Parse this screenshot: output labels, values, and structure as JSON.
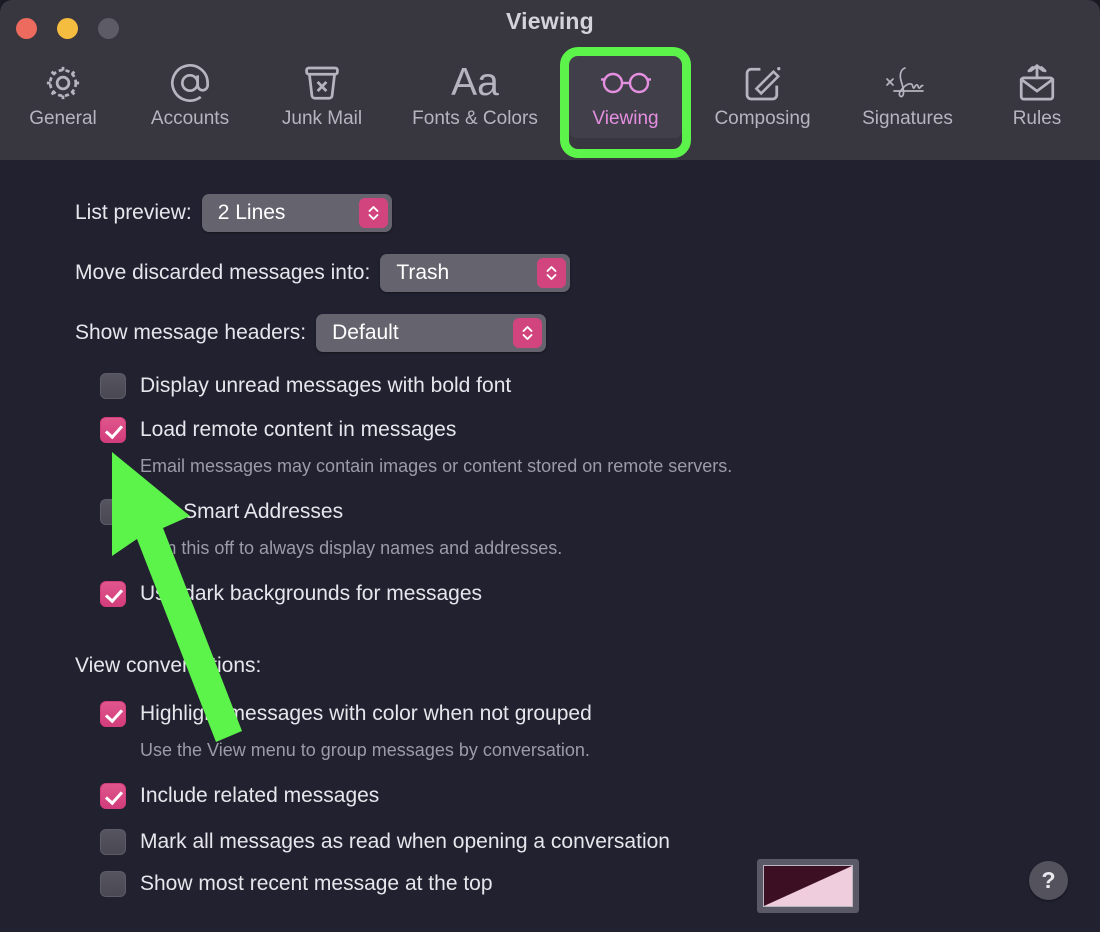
{
  "window": {
    "title": "Viewing",
    "traffic_lights": [
      {
        "name": "close",
        "color": "#ec6a5e"
      },
      {
        "name": "minimize",
        "color": "#f5bd3f"
      },
      {
        "name": "zoom",
        "color": "#5c5b66"
      }
    ]
  },
  "toolbar": {
    "tabs": [
      {
        "label": "General",
        "icon": "gear-icon",
        "selected": false
      },
      {
        "label": "Accounts",
        "icon": "at-sign-icon",
        "selected": false
      },
      {
        "label": "Junk Mail",
        "icon": "trash-x-icon",
        "selected": false
      },
      {
        "label": "Fonts & Colors",
        "icon": "aa-text-icon",
        "selected": false
      },
      {
        "label": "Viewing",
        "icon": "glasses-icon",
        "selected": true
      },
      {
        "label": "Composing",
        "icon": "compose-icon",
        "selected": false
      },
      {
        "label": "Signatures",
        "icon": "signature-icon",
        "selected": false
      },
      {
        "label": "Rules",
        "icon": "envelope-arrows-icon",
        "selected": false
      }
    ],
    "selected_highlight_color": "#5cf34a",
    "selected_tint_color": "#e48fe0"
  },
  "settings": {
    "popups": [
      {
        "label": "List preview:",
        "value": "2 Lines"
      },
      {
        "label": "Move discarded messages into:",
        "value": "Trash"
      },
      {
        "label": "Show message headers:",
        "value": "Default"
      }
    ],
    "checkboxes": [
      {
        "label": "Display unread messages with bold font",
        "checked": false,
        "help": null
      },
      {
        "label": "Load remote content in messages",
        "checked": true,
        "help": "Email messages may contain images or content stored on remote servers."
      },
      {
        "label": "Use Smart Addresses",
        "checked": false,
        "help": "Turn this off to always display names and addresses."
      },
      {
        "label": "Use dark backgrounds for messages",
        "checked": true,
        "help": null
      }
    ],
    "conversations_heading": "View conversations:",
    "conversation_checkboxes": [
      {
        "label": "Highlight messages with color when not grouped",
        "checked": true,
        "help": "Use the View menu to group messages by conversation."
      },
      {
        "label": "Include related messages",
        "checked": true,
        "help": null
      },
      {
        "label": "Mark all messages as read when opening a conversation",
        "checked": false,
        "help": null
      },
      {
        "label": "Show most recent message at the top",
        "checked": false,
        "help": null
      }
    ],
    "highlight_color_swatch": {
      "name": "highlight-color-swatch",
      "color_dark": "#3d0f23",
      "color_light": "#f0cddd"
    }
  },
  "help_button": {
    "label": "?"
  },
  "annotation": {
    "arrow_color": "#5cf34a",
    "points_to": "Load remote content in messages"
  },
  "colors": {
    "window_background": "#212130",
    "toolbar_background": "#38363f",
    "accent_pink": "#d23d7b",
    "text_primary": "#e7e6ec",
    "text_muted": "#9c9ca8",
    "popup_background": "#65636e"
  }
}
